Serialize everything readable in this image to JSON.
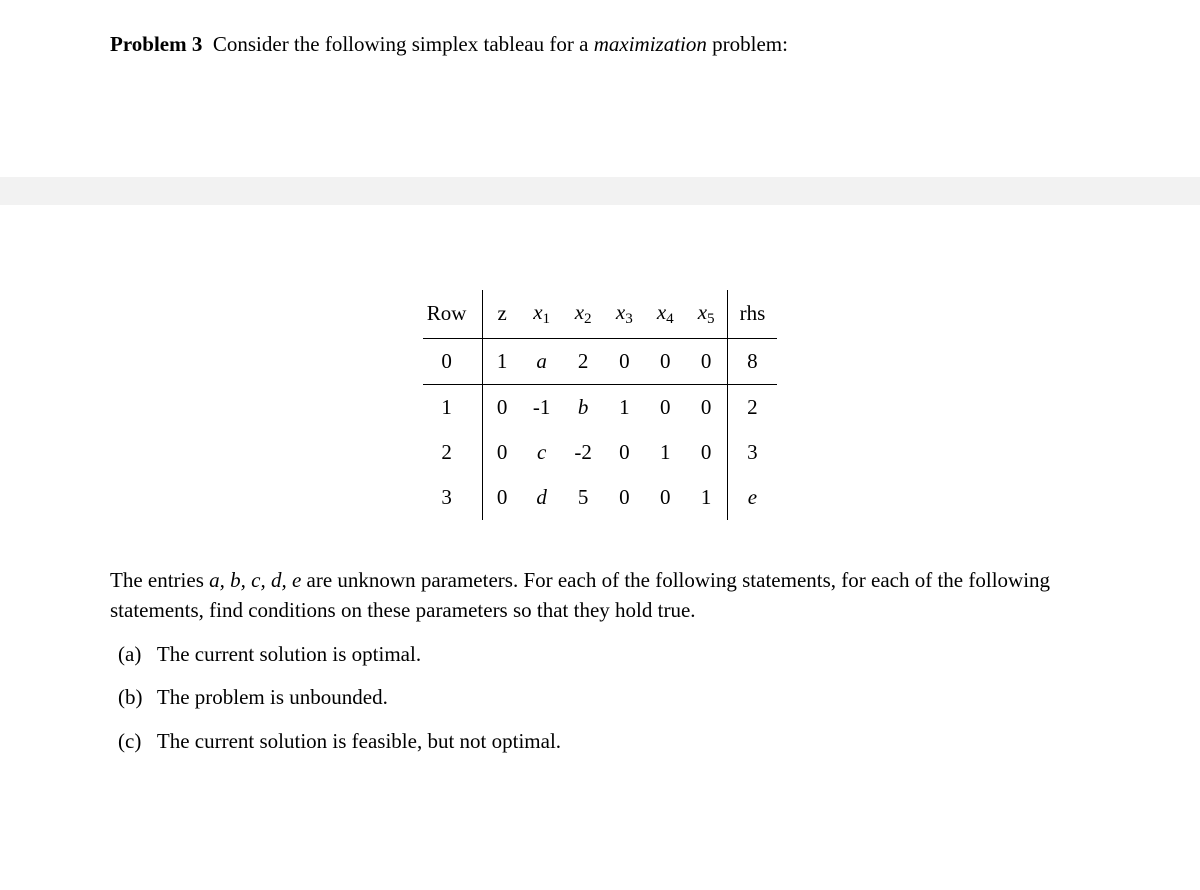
{
  "heading": {
    "label": "Problem 3",
    "text_pre": "Consider the following simplex tableau for a ",
    "text_em": "maximization",
    "text_post": " problem:"
  },
  "tableau": {
    "headers": {
      "row": "Row",
      "z": "z",
      "x1_base": "x",
      "x1_sub": "1",
      "x2_base": "x",
      "x2_sub": "2",
      "x3_base": "x",
      "x3_sub": "3",
      "x4_base": "x",
      "x4_sub": "4",
      "x5_base": "x",
      "x5_sub": "5",
      "rhs": "rhs"
    },
    "rows": [
      {
        "row": "0",
        "z": "1",
        "x1": "a",
        "x1_it": true,
        "x2": "2",
        "x3": "0",
        "x4": "0",
        "x5": "0",
        "rhs": "8"
      },
      {
        "row": "1",
        "z": "0",
        "x1": "-1",
        "x1_it": false,
        "x2": "b",
        "x2_it": true,
        "x3": "1",
        "x4": "0",
        "x5": "0",
        "rhs": "2"
      },
      {
        "row": "2",
        "z": "0",
        "x1": "c",
        "x1_it": true,
        "x2": "-2",
        "x3": "0",
        "x4": "1",
        "x5": "0",
        "rhs": "3"
      },
      {
        "row": "3",
        "z": "0",
        "x1": "d",
        "x1_it": true,
        "x2": "5",
        "x3": "0",
        "x4": "0",
        "x5": "1",
        "rhs": "e",
        "rhs_it": true
      }
    ]
  },
  "followup": {
    "pre": "The entries ",
    "vars": "a, b, c, d, e",
    "post": " are unknown parameters.  For each of the following statements, for each of the following statements, find conditions on these parameters so that they hold true."
  },
  "parts": [
    {
      "label": "(a)",
      "text": "The current solution is optimal."
    },
    {
      "label": "(b)",
      "text": "The problem is unbounded."
    },
    {
      "label": "(c)",
      "text": "The current solution is feasible, but not optimal."
    }
  ]
}
